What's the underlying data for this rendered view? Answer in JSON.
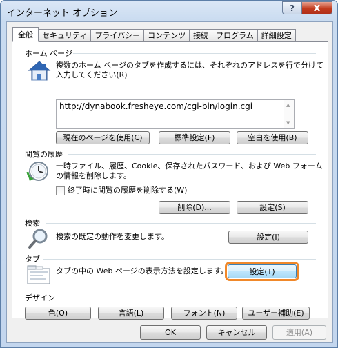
{
  "window": {
    "title": "インターネット オプション",
    "help_label": "?",
    "close_label": "X"
  },
  "tabs": [
    {
      "label": "全般",
      "active": true
    },
    {
      "label": "セキュリティ"
    },
    {
      "label": "プライバシー"
    },
    {
      "label": "コンテンツ"
    },
    {
      "label": "接続"
    },
    {
      "label": "プログラム"
    },
    {
      "label": "詳細設定"
    }
  ],
  "homepage": {
    "section_title": "ホーム ページ",
    "description_line1": "複数のホーム ページのタブを作成するには、それぞれのアドレスを行で分けて",
    "description_line2": "入力してください(R)",
    "url": "http://dynabook.fresheye.com/cgi-bin/login.cgi",
    "buttons": {
      "use_current": "現在のページを使用(C)",
      "use_default": "標準設定(F)",
      "use_blank": "空白を使用(B)"
    }
  },
  "history": {
    "section_title": "閲覧の履歴",
    "description_line1": "一時ファイル、履歴、Cookie、保存されたパスワード、および Web フォーム",
    "description_line2": "の情報を削除します。",
    "checkbox_label": "終了時に閲覧の履歴を削除する(W)",
    "buttons": {
      "delete": "削除(D)...",
      "settings": "設定(S)"
    }
  },
  "search": {
    "section_title": "検索",
    "description": "検索の既定の動作を変更します。",
    "buttons": {
      "settings": "設定(I)"
    }
  },
  "tabs_section": {
    "section_title": "タブ",
    "description": "タブの中の Web ページの表示方法を設定します。",
    "buttons": {
      "settings": "設定(T)"
    }
  },
  "appearance": {
    "section_title": "デザイン",
    "buttons": {
      "colors": "色(O)",
      "languages": "言語(L)",
      "fonts": "フォント(N)",
      "accessibility": "ユーザー補助(E)"
    }
  },
  "footer": {
    "ok": "OK",
    "cancel": "キャンセル",
    "apply": "適用(A)"
  },
  "colors": {
    "highlight": "#f0882a"
  }
}
